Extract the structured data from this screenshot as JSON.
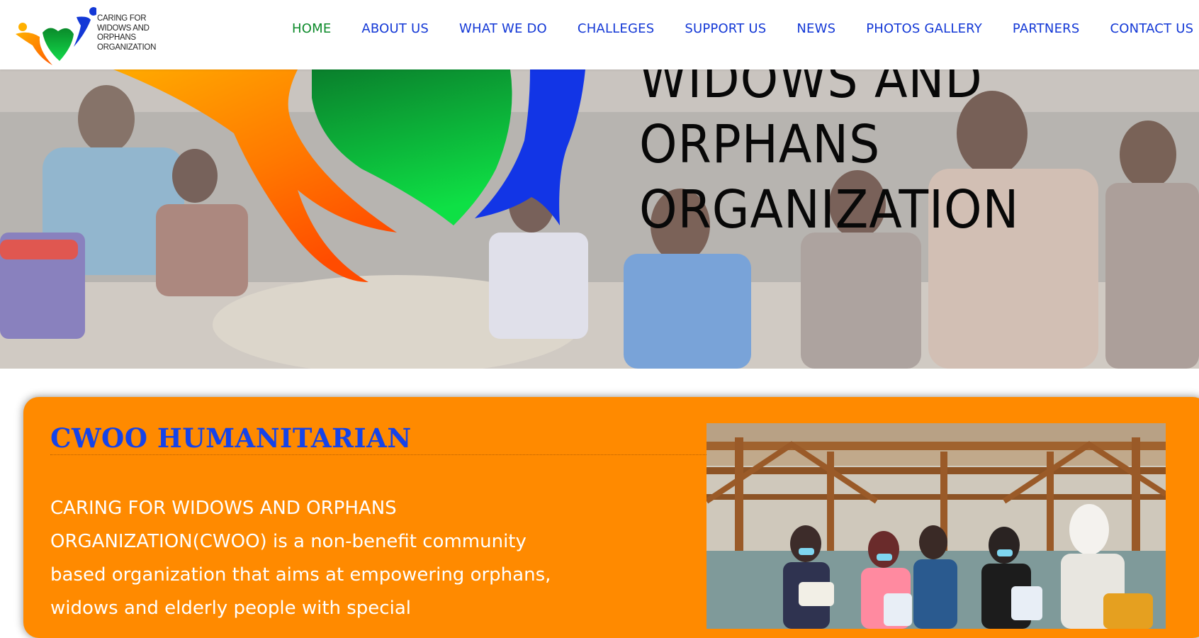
{
  "logo": {
    "alt_lines": [
      "CARING FOR",
      "WIDOWS AND",
      "ORPHANS",
      "ORGANIZATION"
    ],
    "icon": "heart-people-logo-icon"
  },
  "nav": {
    "items": [
      {
        "label": "HOME",
        "active": true
      },
      {
        "label": "ABOUT US",
        "active": false
      },
      {
        "label": "WHAT WE DO",
        "active": false
      },
      {
        "label": "CHALLEGES",
        "active": false
      },
      {
        "label": "SUPPORT US",
        "active": false
      },
      {
        "label": "NEWS",
        "active": false
      },
      {
        "label": "PHOTOS GALLERY",
        "active": false
      },
      {
        "label": "PARTNERS",
        "active": false
      },
      {
        "label": "CONTACT US",
        "active": false
      }
    ]
  },
  "hero": {
    "title_lines": [
      "WIDOWS AND",
      "ORPHANS",
      "ORGANIZATION"
    ]
  },
  "about": {
    "heading": "CWOO HUMANITARIAN",
    "body": "CARING FOR WIDOWS AND ORPHANS ORGANIZATION(CWOO) is a non-benefit community based organization that aims at empowering orphans, widows and elderly people with special"
  },
  "colors": {
    "nav_link": "#1338d6",
    "nav_active": "#0c8a2a",
    "panel_bg": "#ff8a00",
    "panel_heading": "#1543e8"
  }
}
